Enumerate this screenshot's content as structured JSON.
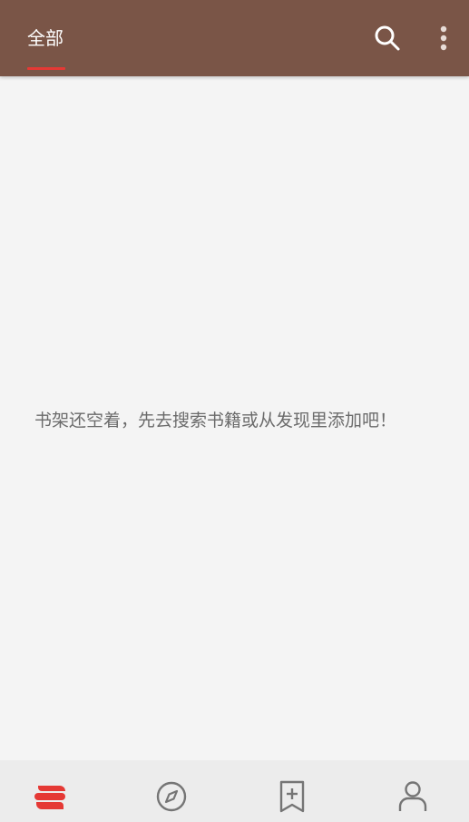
{
  "header": {
    "tabs": [
      {
        "label": "全部",
        "active": true
      }
    ],
    "actions": [
      {
        "icon": "search-icon"
      },
      {
        "icon": "more-vertical-icon"
      }
    ]
  },
  "main": {
    "empty_message": "书架还空着，先去搜索书籍或从发现里添加吧！"
  },
  "bottom_nav": {
    "items": [
      {
        "icon": "bookshelf-icon",
        "active": true
      },
      {
        "icon": "compass-icon",
        "active": false
      },
      {
        "icon": "bookmark-add-icon",
        "active": false
      },
      {
        "icon": "person-icon",
        "active": false
      }
    ]
  },
  "colors": {
    "header_bg": "#7a5547",
    "accent": "#e53935",
    "background": "#f4f4f4",
    "bottom_bg": "#ececec",
    "icon_inactive": "#757575",
    "text_secondary": "#6b6b6b"
  }
}
